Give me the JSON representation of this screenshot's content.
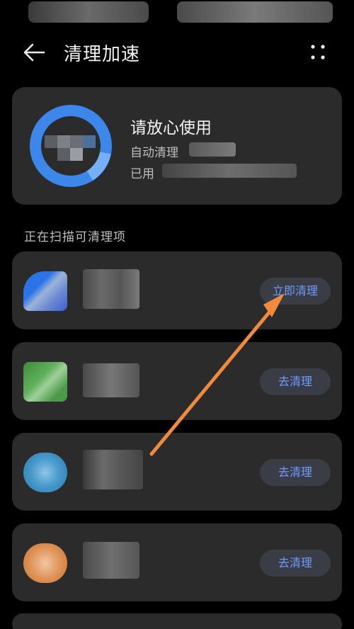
{
  "header": {
    "title": "清理加速",
    "back_icon": "arrow-left-icon",
    "more_icon": "more-dots-icon"
  },
  "summary": {
    "title": "请放心使用",
    "line1": "自动清理",
    "line2": "已用",
    "ring_color": "#3d86ea"
  },
  "section": {
    "label": "正在扫描可清理项"
  },
  "items": [
    {
      "button": "立即清理"
    },
    {
      "button": "去清理"
    },
    {
      "button": "去清理"
    },
    {
      "button": "去清理"
    }
  ],
  "colors": {
    "background": "#000000",
    "card": "#2b2b2b",
    "button_bg": "#3a3d45",
    "button_text": "#6e9bff",
    "annotation_arrow": "#f08a3c"
  }
}
